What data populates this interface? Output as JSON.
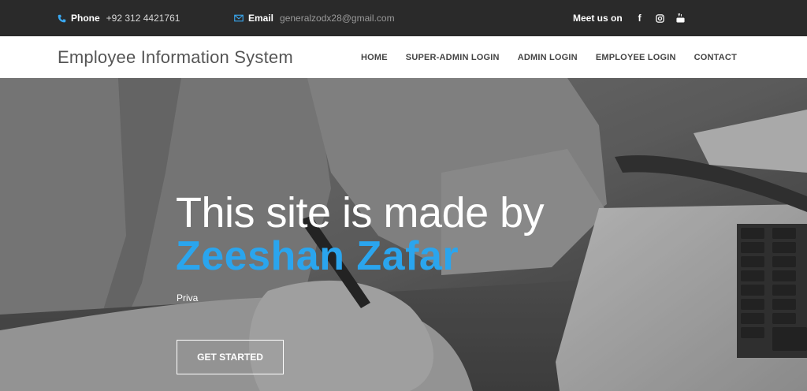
{
  "topbar": {
    "phone_label": "Phone",
    "phone_value": "+92 312 4421761",
    "email_label": "Email",
    "email_value": "generalzodx28@gmail.com",
    "social_label": "Meet us on",
    "social_icons": [
      "facebook-icon",
      "instagram-icon",
      "youtube-icon"
    ],
    "accent_color": "#3aa8f0"
  },
  "navbar": {
    "brand": "Employee Information System",
    "links": [
      "HOME",
      "SUPER-ADMIN LOGIN",
      "ADMIN LOGIN",
      "EMPLOYEE LOGIN",
      "CONTACT"
    ]
  },
  "hero": {
    "line1": "This site is made by",
    "line2": "Zeeshan Zafar",
    "subtitle": "Priva",
    "cta_label": "GET STARTED",
    "highlight_color": "#2aa5ee"
  }
}
